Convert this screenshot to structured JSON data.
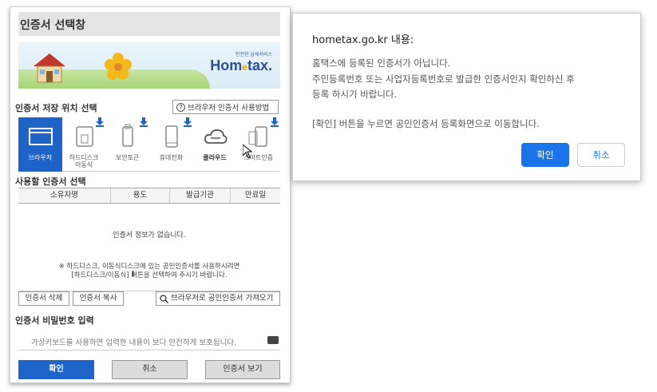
{
  "cert_window": {
    "title": "인증서 선택창",
    "banner": {
      "logo_small": "안전한 납세서비스",
      "logo_main": "Hom",
      "logo_e": "e",
      "logo_tail": "tax."
    },
    "storage_section_title": "인증서 저장 위치 선택",
    "help_button": "브라우저 인증서 사용방법",
    "storage_items": [
      {
        "label": "브라우저",
        "icon": "browser-icon",
        "active": true
      },
      {
        "label": "하드디스크\n이동식",
        "icon": "usb-drive-icon",
        "active": false
      },
      {
        "label": "보안토큰",
        "icon": "security-token-icon",
        "active": false
      },
      {
        "label": "휴대전화",
        "icon": "mobile-phone-icon",
        "active": false
      },
      {
        "label": "클라우드",
        "icon": "cloud-icon",
        "active": false
      },
      {
        "label": "스마트인증",
        "icon": "smart-auth-icon",
        "active": false
      }
    ],
    "cert_list_title": "사용할 인증서 선택",
    "columns": [
      "소유자명",
      "용도",
      "발급기관",
      "만료일"
    ],
    "empty_message": "인증서 정보가 없습니다.",
    "notice_line1": "※ 하드디스크, 이동식디스크에 있는 공인인증서를 사용하시려면",
    "notice_line2": "[하드디스크/이동식] 버튼을 선택하여 주시기 바랍니다.",
    "delete_button": "인증서 삭제",
    "copy_button": "인증서 복사",
    "import_button": "브라우저로 공인인증서 가져오기",
    "password_title": "인증서 비밀번호 입력",
    "password_placeholder": "가상키보드를 사용하면 입력한 내용이 보다 안전하게 보호됩니다.",
    "ok_button": "확인",
    "cancel_button": "취소",
    "view_button": "인증서 보기"
  },
  "dialog": {
    "origin": "hometax.go.kr 내용:",
    "line1": "홈택스에 등록된 인증서가 아닙니다.",
    "line2": "주민등록번호 또는 사업자등록번호로 발급한 인증서인지 확인하신 후",
    "line3": "등록 하시기 바랍니다.",
    "line4": "[확인] 버튼을 누르면 공인인증서 등록화면으로 이동합니다.",
    "ok_button": "확인",
    "cancel_button": "취소"
  },
  "colors": {
    "accent_blue": "#1e63c8",
    "dialog_blue": "#1a73e8"
  }
}
